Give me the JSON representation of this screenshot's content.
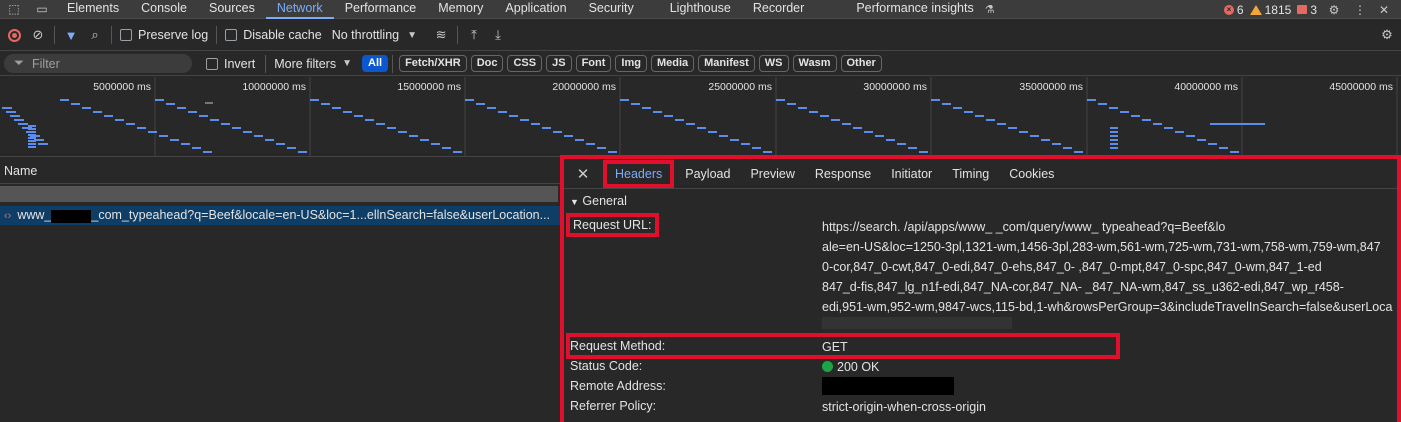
{
  "tabs": [
    "Elements",
    "Console",
    "Sources",
    "Network",
    "Performance",
    "Memory",
    "Application",
    "Security",
    "Lighthouse",
    "Recorder",
    "Performance insights"
  ],
  "counts": {
    "errors": "6",
    "warnings": "1815",
    "issues": "3"
  },
  "toolbar": {
    "preserve_log": "Preserve log",
    "disable_cache": "Disable cache",
    "throttling": "No throttling"
  },
  "filter": {
    "placeholder": "Filter",
    "invert": "Invert",
    "more_filters": "More filters",
    "types": [
      "All",
      "Fetch/XHR",
      "Doc",
      "CSS",
      "JS",
      "Font",
      "Img",
      "Media",
      "Manifest",
      "WS",
      "Wasm",
      "Other"
    ]
  },
  "timeline": {
    "ticks": [
      "5000000 ms",
      "10000000 ms",
      "15000000 ms",
      "20000000 ms",
      "25000000 ms",
      "30000000 ms",
      "35000000 ms",
      "40000000 ms",
      "45000000 ms"
    ]
  },
  "list": {
    "header": "Name",
    "row": {
      "prefix": "www_",
      "text": "_com_typeahead?q=Beef&locale=en-US&loc=1...ellnSearch=false&userLocation..."
    }
  },
  "detail": {
    "tabs": [
      "Headers",
      "Payload",
      "Preview",
      "Response",
      "Initiator",
      "Timing",
      "Cookies"
    ],
    "section": "General",
    "request_url_label": "Request URL:",
    "request_url_lines": [
      "https://search.                /api/apps/www_           _com/query/www_                    typeahead?q=Beef&lo",
      "ale=en-US&loc=1250-3pl,1321-wm,1456-3pl,283-wm,561-wm,725-wm,731-wm,758-wm,759-wm,847",
      "0-cor,847_0-cwt,847_0-edi,847_0-ehs,847_0-                  ,847_0-mpt,847_0-spc,847_0-wm,847_1-ed",
      "847_d-fis,847_lg_n1f-edi,847_NA-cor,847_NA-                  _847_NA-wm,847_ss_u362-edi,847_wp_r458-",
      "edi,951-wm,952-wm,9847-wcs,115-bd,1-wh&rowsPerGroup=3&includeTravelInSearch=false&userLoca"
    ],
    "method_label": "Request Method:",
    "method_value": "GET",
    "status_label": "Status Code:",
    "status_value": "200 OK",
    "remote_label": "Remote Address:",
    "referrer_label": "Referrer Policy:",
    "referrer_value": "strict-origin-when-cross-origin"
  }
}
